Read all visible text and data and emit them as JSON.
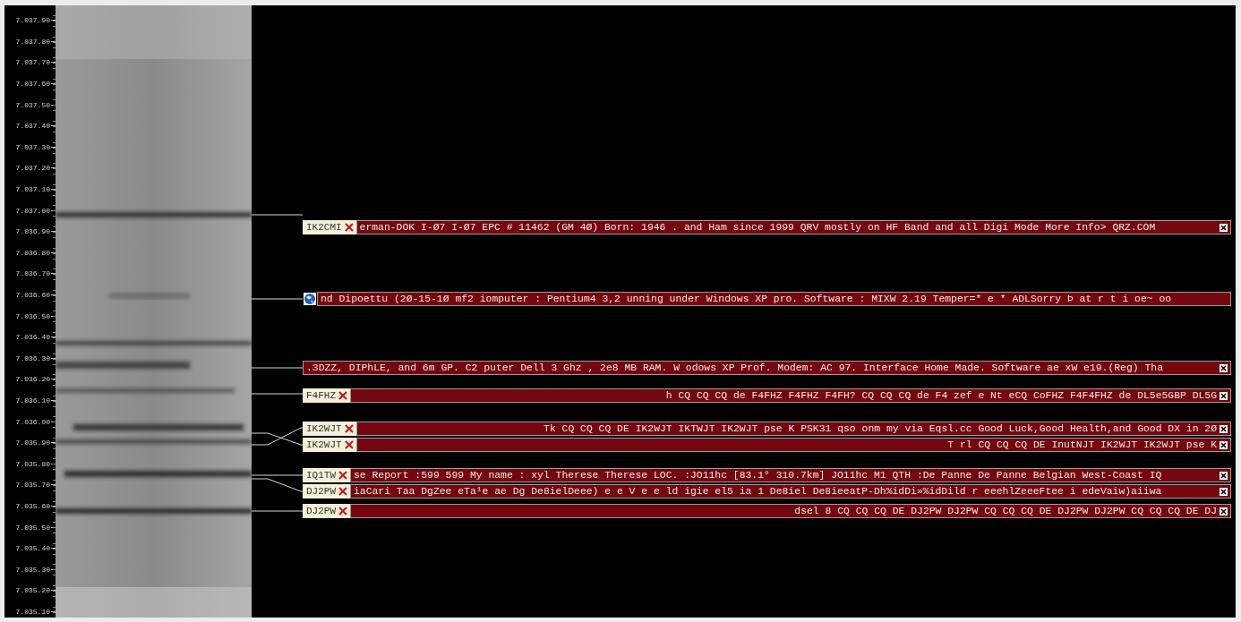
{
  "frequency_axis": {
    "labels": [
      "7.037.90",
      "7.037.80",
      "7.037.70",
      "7.037.60",
      "7.037.50",
      "7.037.40",
      "7.037.30",
      "7.037.20",
      "7.037.10",
      "7.037.00",
      "7.036.90",
      "7.036.80",
      "7.036.70",
      "7.036.60",
      "7.036.50",
      "7.036.40",
      "7.036.30",
      "7.036.20",
      "7.036.10",
      "7.036.00",
      "7.035.90",
      "7.035.80",
      "7.035.70",
      "7.035.60",
      "7.035.50",
      "7.035.40",
      "7.035.30",
      "7.035.20",
      "7.035.10"
    ]
  },
  "decodes": [
    {
      "kind": "callsign",
      "callsign": "IK2CMI",
      "text": "erman-DOK I-Ø7 I-Ø7 EPC # 11462 (GM 4Ø) Born: 1946 . and Ham since 1999 QRV mostly on HF Band and all Digi Mode More Info> QRZ.COM",
      "right_aligned": false,
      "closable": true
    },
    {
      "kind": "globe",
      "text": "nd Dipoettu (2Ø-15-1Ø mf2 iomputer : Pentium4 3,2 unning under Windows XP pro. Software : MIXW 2.19 Temper=* e * ADLSorry Þ at r t i oe~ oo",
      "right_aligned": false,
      "closable": false
    },
    {
      "kind": "none",
      "text": ".3DZZ, DIPhLE, and 6m GP. C2 puter Dell 3 Ghz , 2e8 MB RAM. W odows XP Prof. Modem: AC 97. Interface Home Made. Software ae xW e19.(Reg) Tha",
      "right_aligned": false,
      "closable": true
    },
    {
      "kind": "callsign",
      "callsign": "F4FHZ",
      "text": "h CQ CQ CQ de F4FHZ F4FHZ F4FH? CQ CQ CQ de F4 zef e Nt eCQ CoFHZ F4F4FHZ de DL5e5GBP DL5G",
      "right_aligned": true,
      "closable": true
    },
    {
      "kind": "callsign",
      "callsign": "IK2WJT",
      "text": "Tk CQ CQ CQ DE IK2WJT IKTWJT IK2WJT pse K PSK31 qso onm my via Eqsl.cc Good Luck,Good Health,and Good DX in 2Ø",
      "right_aligned": true,
      "closable": true
    },
    {
      "kind": "callsign",
      "callsign": "IK2WJT",
      "text": "T rl CQ CQ CQ DE InutNJT IK2WJT IK2WJT pse K",
      "right_aligned": true,
      "closable": true
    },
    {
      "kind": "callsign",
      "callsign": "IQ1TW",
      "text": "se Report :599 599 My name : xyl Therese Therese LOC. :JO11hc [83.1° 310.7km] JO11hc M1 QTH :De Panne De Panne Belgian West-Coast IQ",
      "right_aligned": false,
      "closable": true
    },
    {
      "kind": "callsign",
      "callsign": "DJ2PW",
      "text": "iaCari Taa DgZee eTa¹e ae Dg De8ielDeee) e e V e e ld igie el5 ia 1 De8iel De8ieeatP-Dh%idDi»%idDild r eeehlZeeeFtee i edeVaiw)aiiwa",
      "right_aligned": false,
      "closable": true
    },
    {
      "kind": "callsign",
      "callsign": "DJ2PW",
      "text": "dsel 8 CQ CQ CQ DE DJ2PW DJ2PW CQ CQ CQ DE DJ2PW DJ2PW CQ CQ CQ DE DJ",
      "right_aligned": true,
      "closable": true
    }
  ]
}
